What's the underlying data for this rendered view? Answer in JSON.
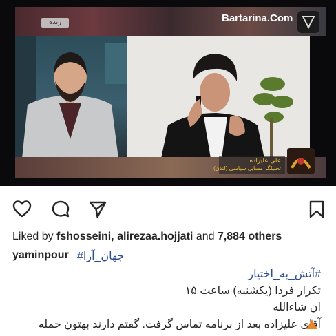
{
  "photo": {
    "live_badge": "زنده",
    "watermark": "Bartarina.Com",
    "guest_name": "علی علیزاده",
    "guest_title": "تحلیلگر مسایل سیاسی (لندن)"
  },
  "actions": {
    "like_icon": "heart-icon",
    "comment_icon": "comment-icon",
    "share_icon": "paper-plane-icon",
    "save_icon": "bookmark-icon"
  },
  "likes": {
    "prefix": "Liked by ",
    "users": "fshosseini, alirezaa.hojjati",
    "middle": " and ",
    "count": "7,884 others"
  },
  "caption": {
    "username": "yaminpour",
    "hashtag_1": "#جهان_آرا",
    "hashtag_2": "#آتش_به_اختیار",
    "line_rerun": "تکرار فردا (یکشنبه) ساعت ۱۵",
    "line_inshallah": "ان شاءالله",
    "line_warning": "آقای علیزاده بعد از برنامه تماس گرفت. گفتم دارند بهتون حمله"
  },
  "colors": {
    "hashtag": "#2b4d93",
    "warning": "#e8862a"
  }
}
